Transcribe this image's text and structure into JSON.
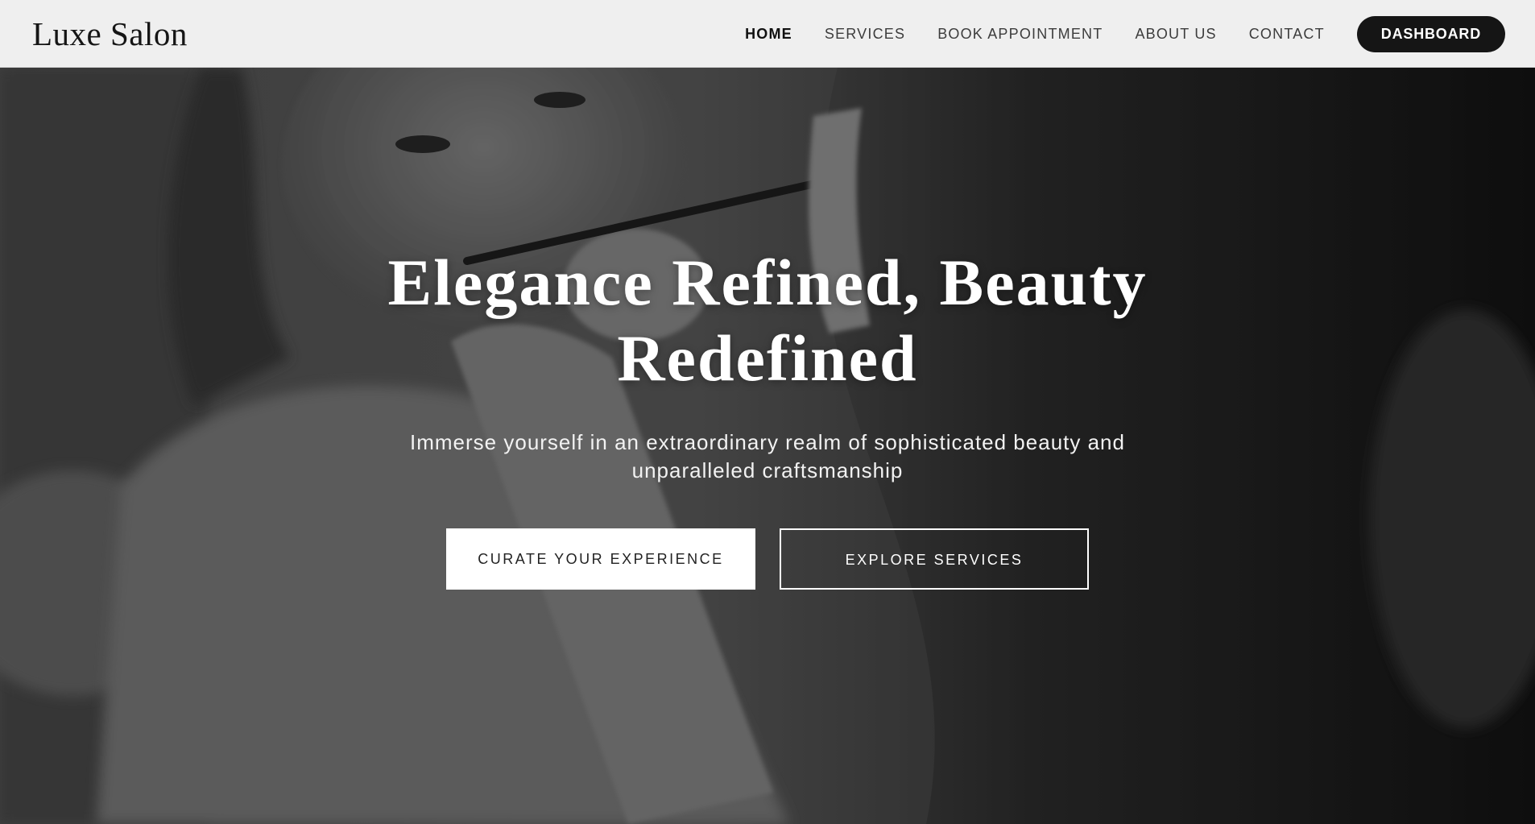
{
  "header": {
    "brand": "Luxe Salon",
    "nav": {
      "home": "HOME",
      "services": "SERVICES",
      "book": "BOOK APPOINTMENT",
      "about": "ABOUT US",
      "contact": "CONTACT",
      "dashboard": "DASHBOARD"
    },
    "active_item": "HOME"
  },
  "hero": {
    "title": "Elegance Refined, Beauty Redefined",
    "subtitle": "Immerse yourself in an extraordinary realm of sophisticated beauty and unparalleled craftsmanship",
    "primary_button": "CURATE YOUR EXPERIENCE",
    "secondary_button": "EXPLORE SERVICES",
    "background_image": "grayscale photo of a makeup artist applying eyeliner to a client"
  },
  "colors": {
    "header_bg": "#efefef",
    "brand_text": "#151515",
    "dashboard_bg": "#151515",
    "hero_text": "#ffffff"
  }
}
